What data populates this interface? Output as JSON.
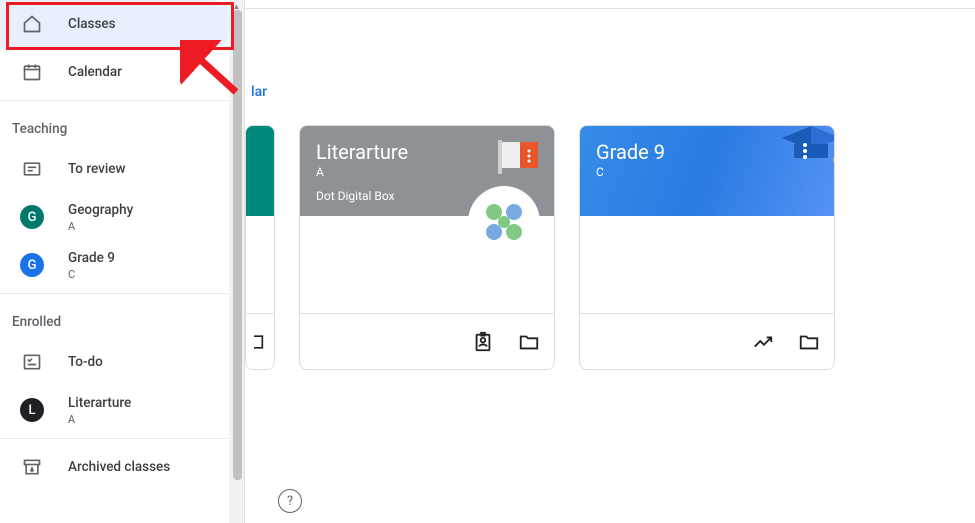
{
  "sidebar": {
    "classes_label": "Classes",
    "calendar_label": "Calendar",
    "teaching_label": "Teaching",
    "to_review_label": "To review",
    "geography": {
      "name": "Geography",
      "section": "A",
      "initial": "G"
    },
    "grade9": {
      "name": "Grade 9",
      "section": "C",
      "initial": "G"
    },
    "enrolled_label": "Enrolled",
    "todo_label": "To-do",
    "literarture": {
      "name": "Literarture",
      "section": "A",
      "initial": "L"
    },
    "archived_label": "Archived classes"
  },
  "main": {
    "partial_link": "lar",
    "card1": {
      "title": "Literarture",
      "section": "A",
      "teacher": "Dot Digital Box"
    },
    "card2": {
      "title": "Grade 9",
      "section": "C"
    }
  },
  "help": "?"
}
